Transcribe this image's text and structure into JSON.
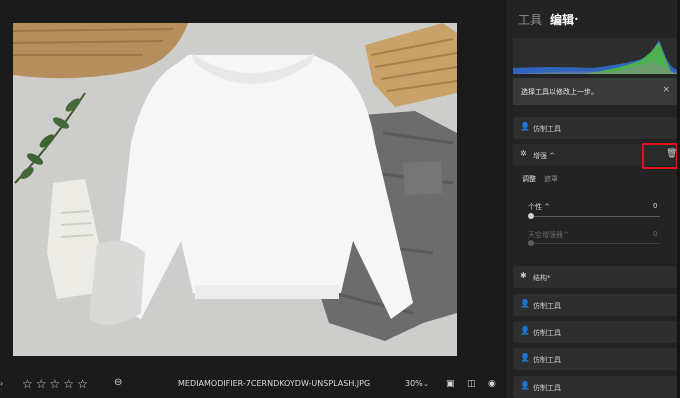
{
  "panel": {
    "tab_tools": "工具",
    "tab_edit": "编辑",
    "tooltip": "选择工具以修改上一步。",
    "tooltip_close": "×",
    "rows": [
      {
        "label": "仿制工具",
        "icon": "person-icon"
      },
      {
        "label": "增强 ^",
        "icon": "sparkle-icon"
      },
      {
        "label": "结构*",
        "icon": "gear-icon"
      },
      {
        "label": "仿制工具",
        "icon": "person-icon"
      },
      {
        "label": "仿制工具",
        "icon": "person-icon"
      },
      {
        "label": "仿制工具",
        "icon": "person-icon"
      },
      {
        "label": "仿制工具",
        "icon": "person-icon"
      }
    ],
    "sub_tabs": [
      "调整",
      "遮罩"
    ],
    "sliders": [
      {
        "label": "个性 ^",
        "value": "0",
        "level": 0
      },
      {
        "label": "天空增强器^",
        "value": "0",
        "level": 0
      }
    ]
  },
  "bottom": {
    "filename": "MEDIAMODIFIER-7CERNDKOYDW-UNSPLASH.JPG",
    "zoom": "30%",
    "rating": 0
  },
  "colors": {
    "highlight": "#e0101e",
    "hist_green": "#4caf50",
    "hist_blue": "#2f6fd6"
  }
}
